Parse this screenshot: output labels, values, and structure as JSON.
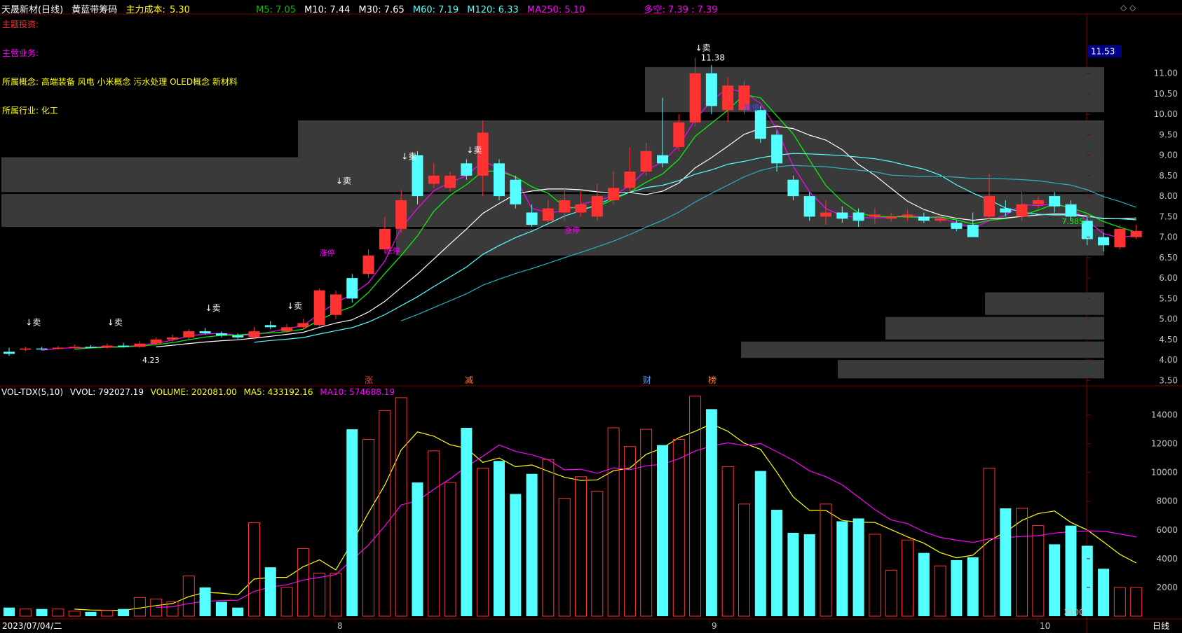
{
  "header": {
    "stock": "天晟新材(日线)",
    "indicator": "黄蓝带筹码",
    "cost_label": "主力成本:",
    "cost_value": "5.30",
    "ma": [
      "M5: 7.05",
      "M10: 7.44",
      "M30: 7.65",
      "M60: 7.19",
      "M120: 6.33",
      "MA250: 5.10"
    ],
    "duokong": "多空: 7.39 : 7.39",
    "controls": "◇ ◇"
  },
  "info": {
    "theme": "主题投资:",
    "business": "主营业务:",
    "concepts": "所属概念:  高端装备  风电  小米概念  污水处理  OLED概念  新材料",
    "industry": "所属行业:  化工"
  },
  "price_axis": {
    "current": "11.53",
    "ticks": [
      "11.00",
      "10.50",
      "10.00",
      "9.50",
      "9.00",
      "8.50",
      "8.00",
      "7.50",
      "7.00",
      "6.50",
      "6.00",
      "5.50",
      "5.00",
      "4.50",
      "4.00",
      "3.50"
    ]
  },
  "annotations": {
    "high": "11.38",
    "low": "4.23",
    "last": "7.385",
    "zhangting": "涨停",
    "dieting": "跌停",
    "sell": "↓卖",
    "events": [
      "涨",
      "减",
      "财",
      "榜"
    ]
  },
  "volume": {
    "title": "VOL-TDX(5,10)",
    "vvol": "VVOL: 792027.19",
    "volume": "VOLUME: 202081.00",
    "ma5": "MA5: 433192.16",
    "ma10": "MA10: 574688.19",
    "ticks": [
      "14000",
      "12000",
      "10000",
      "8000",
      "6000",
      "4000",
      "2000"
    ],
    "unit": "X100"
  },
  "date_axis": {
    "date": "2023/07/04/二",
    "months": [
      "8",
      "9",
      "10"
    ],
    "period": "日线"
  },
  "colors": {
    "up": "#ff3232",
    "down": "#54ffff",
    "yellow": "#ffff00",
    "magenta": "#ff00ff",
    "green": "#00ff00",
    "blue": "#0000ff",
    "grid": "#800000",
    "axis_text": "#c0c0c0"
  },
  "chart_data": {
    "type": "candlestick",
    "price_range": [
      3.3,
      11.9
    ],
    "volume_range": [
      0,
      15000
    ],
    "candles": [
      {
        "o": 4.2,
        "c": 4.15,
        "h": 4.3,
        "l": 4.1,
        "v": 600
      },
      {
        "o": 4.25,
        "c": 4.28,
        "h": 4.32,
        "l": 4.22,
        "v": 500
      },
      {
        "o": 4.28,
        "c": 4.27,
        "h": 4.32,
        "l": 4.24,
        "v": 500
      },
      {
        "o": 4.27,
        "c": 4.3,
        "h": 4.34,
        "l": 4.25,
        "v": 500
      },
      {
        "o": 4.3,
        "c": 4.32,
        "h": 4.38,
        "l": 4.27,
        "v": 350
      },
      {
        "o": 4.32,
        "c": 4.3,
        "h": 4.36,
        "l": 4.28,
        "v": 300
      },
      {
        "o": 4.3,
        "c": 4.35,
        "h": 4.4,
        "l": 4.28,
        "v": 400
      },
      {
        "o": 4.35,
        "c": 4.32,
        "h": 4.42,
        "l": 4.3,
        "v": 500
      },
      {
        "o": 4.32,
        "c": 4.4,
        "h": 4.46,
        "l": 4.3,
        "v": 1300
      },
      {
        "o": 4.4,
        "c": 4.5,
        "h": 4.55,
        "l": 4.38,
        "v": 1200
      },
      {
        "o": 4.5,
        "c": 4.55,
        "h": 4.62,
        "l": 4.45,
        "v": 1000
      },
      {
        "o": 4.55,
        "c": 4.7,
        "h": 4.75,
        "l": 4.5,
        "v": 2800
      },
      {
        "o": 4.7,
        "c": 4.65,
        "h": 4.78,
        "l": 4.62,
        "v": 2000
      },
      {
        "o": 4.65,
        "c": 4.6,
        "h": 4.7,
        "l": 4.55,
        "v": 1000
      },
      {
        "o": 4.6,
        "c": 4.55,
        "h": 4.65,
        "l": 4.5,
        "v": 600
      },
      {
        "o": 4.55,
        "c": 4.7,
        "h": 4.8,
        "l": 4.5,
        "v": 6500
      },
      {
        "o": 4.85,
        "c": 4.8,
        "h": 4.95,
        "l": 4.75,
        "v": 3400
      },
      {
        "o": 4.7,
        "c": 4.8,
        "h": 4.88,
        "l": 4.66,
        "v": 2000
      },
      {
        "o": 4.8,
        "c": 4.9,
        "h": 5.0,
        "l": 4.75,
        "v": 4700
      },
      {
        "o": 4.85,
        "c": 5.7,
        "h": 5.75,
        "l": 4.8,
        "v": 3000
      },
      {
        "o": 5.1,
        "c": 5.6,
        "h": 5.7,
        "l": 5.0,
        "v": 3000
      },
      {
        "o": 6.0,
        "c": 5.5,
        "h": 6.1,
        "l": 5.4,
        "v": 13000
      },
      {
        "o": 6.1,
        "c": 6.55,
        "h": 6.7,
        "l": 6.0,
        "v": 12300
      },
      {
        "o": 6.7,
        "c": 7.2,
        "h": 7.5,
        "l": 6.6,
        "v": 14300
      },
      {
        "o": 7.2,
        "c": 7.9,
        "h": 8.15,
        "l": 7.1,
        "v": 15200
      },
      {
        "o": 9.0,
        "c": 8.0,
        "h": 9.1,
        "l": 7.8,
        "v": 9300
      },
      {
        "o": 8.3,
        "c": 8.5,
        "h": 8.8,
        "l": 8.2,
        "v": 11500
      },
      {
        "o": 8.2,
        "c": 8.5,
        "h": 8.6,
        "l": 8.1,
        "v": 9300
      },
      {
        "o": 8.8,
        "c": 8.5,
        "h": 8.9,
        "l": 8.4,
        "v": 13100
      },
      {
        "o": 8.5,
        "c": 9.55,
        "h": 9.85,
        "l": 8.0,
        "v": 10300
      },
      {
        "o": 8.8,
        "c": 8.0,
        "h": 8.9,
        "l": 7.9,
        "v": 10800
      },
      {
        "o": 8.4,
        "c": 7.8,
        "h": 8.5,
        "l": 7.7,
        "v": 8500
      },
      {
        "o": 7.6,
        "c": 7.3,
        "h": 7.8,
        "l": 7.25,
        "v": 9900
      },
      {
        "o": 7.4,
        "c": 7.7,
        "h": 7.9,
        "l": 7.35,
        "v": 10900
      },
      {
        "o": 7.6,
        "c": 7.9,
        "h": 8.2,
        "l": 7.4,
        "v": 8200
      },
      {
        "o": 7.6,
        "c": 7.8,
        "h": 8.1,
        "l": 7.5,
        "v": 9700
      },
      {
        "o": 7.5,
        "c": 8.0,
        "h": 8.3,
        "l": 7.4,
        "v": 8700
      },
      {
        "o": 7.9,
        "c": 8.2,
        "h": 8.6,
        "l": 7.8,
        "v": 13100
      },
      {
        "o": 8.2,
        "c": 8.6,
        "h": 9.2,
        "l": 8.1,
        "v": 11800
      },
      {
        "o": 8.6,
        "c": 9.1,
        "h": 9.3,
        "l": 8.5,
        "v": 13000
      },
      {
        "o": 9.0,
        "c": 8.8,
        "h": 10.4,
        "l": 8.7,
        "v": 11900
      },
      {
        "o": 9.2,
        "c": 9.8,
        "h": 10.0,
        "l": 9.1,
        "v": 12300
      },
      {
        "o": 9.8,
        "c": 11.0,
        "h": 11.38,
        "l": 9.7,
        "v": 15300
      },
      {
        "o": 11.0,
        "c": 10.2,
        "h": 11.2,
        "l": 10.0,
        "v": 14400
      },
      {
        "o": 10.1,
        "c": 10.7,
        "h": 10.9,
        "l": 9.8,
        "v": 10400
      },
      {
        "o": 10.1,
        "c": 10.7,
        "h": 10.8,
        "l": 10.0,
        "v": 7800
      },
      {
        "o": 10.1,
        "c": 9.4,
        "h": 10.2,
        "l": 9.3,
        "v": 10100
      },
      {
        "o": 9.5,
        "c": 8.8,
        "h": 9.6,
        "l": 8.6,
        "v": 7400
      },
      {
        "o": 8.4,
        "c": 8.0,
        "h": 8.5,
        "l": 7.9,
        "v": 5800
      },
      {
        "o": 8.0,
        "c": 7.5,
        "h": 8.1,
        "l": 7.4,
        "v": 5700
      },
      {
        "o": 7.5,
        "c": 7.6,
        "h": 7.9,
        "l": 7.3,
        "v": 7800
      },
      {
        "o": 7.6,
        "c": 7.45,
        "h": 7.75,
        "l": 7.35,
        "v": 6600
      },
      {
        "o": 7.6,
        "c": 7.4,
        "h": 7.7,
        "l": 7.25,
        "v": 6800
      },
      {
        "o": 7.5,
        "c": 7.55,
        "h": 7.7,
        "l": 7.3,
        "v": 5700
      },
      {
        "o": 7.45,
        "c": 7.5,
        "h": 7.6,
        "l": 7.38,
        "v": 3200
      },
      {
        "o": 7.5,
        "c": 7.55,
        "h": 7.65,
        "l": 7.4,
        "v": 5300
      },
      {
        "o": 7.5,
        "c": 7.4,
        "h": 7.6,
        "l": 7.35,
        "v": 4400
      },
      {
        "o": 7.4,
        "c": 7.45,
        "h": 7.55,
        "l": 7.35,
        "v": 3500
      },
      {
        "o": 7.35,
        "c": 7.2,
        "h": 7.4,
        "l": 7.15,
        "v": 3900
      },
      {
        "o": 7.3,
        "c": 7.0,
        "h": 7.6,
        "l": 7.0,
        "v": 4100
      },
      {
        "o": 7.5,
        "c": 8.0,
        "h": 8.55,
        "l": 7.4,
        "v": 10300
      },
      {
        "o": 7.7,
        "c": 7.6,
        "h": 7.9,
        "l": 7.5,
        "v": 7500
      },
      {
        "o": 7.5,
        "c": 7.8,
        "h": 8.1,
        "l": 7.4,
        "v": 7500
      },
      {
        "o": 7.8,
        "c": 7.9,
        "h": 8.0,
        "l": 7.7,
        "v": 6300
      },
      {
        "o": 8.0,
        "c": 7.75,
        "h": 8.1,
        "l": 7.6,
        "v": 5000
      },
      {
        "o": 7.8,
        "c": 7.5,
        "h": 7.9,
        "l": 7.4,
        "v": 6300
      },
      {
        "o": 7.4,
        "c": 6.95,
        "h": 7.5,
        "l": 6.8,
        "v": 4900
      },
      {
        "o": 7.0,
        "c": 6.8,
        "h": 7.1,
        "l": 6.65,
        "v": 3300
      },
      {
        "o": 6.75,
        "c": 7.2,
        "h": 7.3,
        "l": 6.7,
        "v": 2000
      },
      {
        "o": 7.0,
        "c": 7.15,
        "h": 7.3,
        "l": 6.95,
        "v": 2000
      }
    ]
  }
}
